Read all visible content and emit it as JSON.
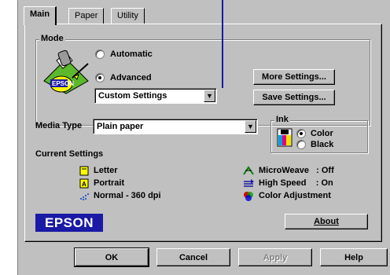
{
  "tabs": [
    {
      "label": "Main"
    },
    {
      "label": "Paper"
    },
    {
      "label": "Utility"
    }
  ],
  "mode": {
    "title": "Mode",
    "automatic_label": "Automatic",
    "advanced_label": "Advanced",
    "selected": "Advanced",
    "settings_select": "Custom Settings",
    "more_settings_label": "More Settings...",
    "save_settings_label": "Save Settings...",
    "logo_text": "EPSON"
  },
  "media_type": {
    "label": "Media Type",
    "value": "Plain paper"
  },
  "ink": {
    "title": "Ink",
    "color_label": "Color",
    "black_label": "Black",
    "selected": "Color"
  },
  "current_settings": {
    "title": "Current Settings",
    "left": [
      {
        "text": "Letter",
        "icon": "paper-size-icon"
      },
      {
        "text": "Portrait",
        "icon": "orientation-icon"
      },
      {
        "text": "Normal - 360 dpi",
        "icon": "resolution-icon"
      }
    ],
    "right": [
      {
        "text": "MicroWeave   : Off",
        "icon": "microweave-icon"
      },
      {
        "text": "High Speed    : On",
        "icon": "high-speed-icon"
      },
      {
        "text": "Color Adjustment",
        "icon": "color-adjust-icon"
      }
    ]
  },
  "brand": {
    "logo": "EPSON",
    "color": "#1a1aa6"
  },
  "about_label": "About",
  "buttons": {
    "ok": "OK",
    "cancel": "Cancel",
    "apply": "Apply",
    "help": "Help"
  },
  "colors": {
    "face": "#c0c0c0",
    "pointer_line": "#1a1a9c"
  }
}
